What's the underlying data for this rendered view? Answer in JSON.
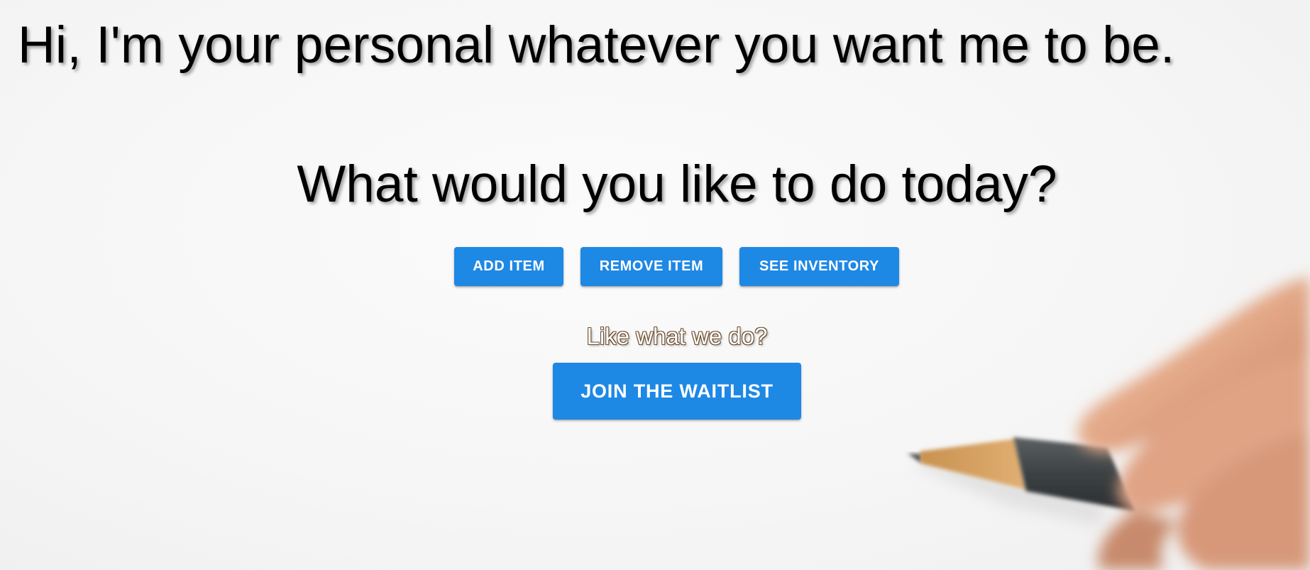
{
  "hero": {
    "title": "Hi, I'm your personal whatever you want me to be."
  },
  "prompt": {
    "heading": "What would you like to do today?"
  },
  "actions": {
    "add_item": "ADD ITEM",
    "remove_item": "REMOVE ITEM",
    "see_inventory": "SEE INVENTORY"
  },
  "cta": {
    "text": "Like what we do?",
    "button": "JOIN THE WAITLIST"
  },
  "colors": {
    "button_primary": "#1e88e5",
    "text_primary": "#000000",
    "background": "#f7f7f7"
  }
}
